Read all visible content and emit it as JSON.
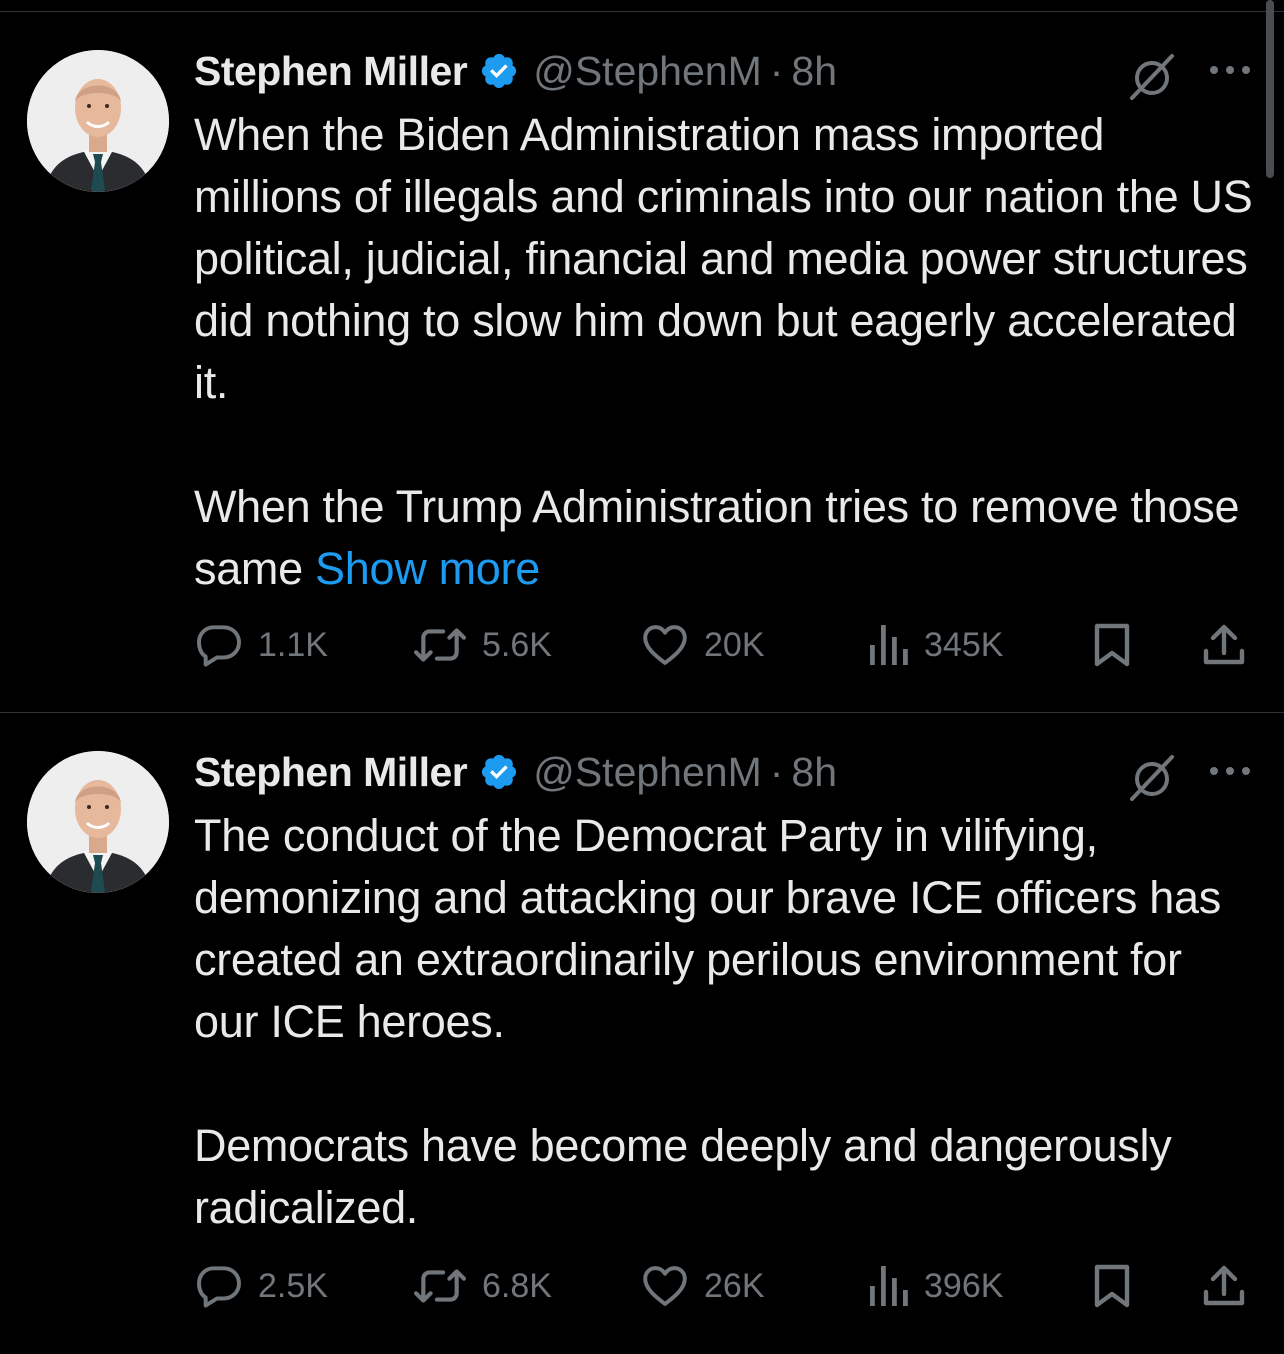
{
  "colors": {
    "background": "#000000",
    "text": "#e7e9ea",
    "muted": "#71767b",
    "accent": "#1d9bf0",
    "divider": "#2f3336"
  },
  "tweets": [
    {
      "author": {
        "name": "Stephen Miller",
        "verified_icon": "verified-badge-icon",
        "handle": "@StephenM",
        "separator": "·",
        "time": "8h"
      },
      "paragraphs": [
        "When the Biden Administration mass imported millions of illegals and criminals into our nation the US political, judicial, financial and media power structures did nothing to slow him down but eagerly accelerated it.",
        "When the Trump Administration tries to remove those same "
      ],
      "show_more": "Show more",
      "actions": {
        "replies": "1.1K",
        "reposts": "5.6K",
        "likes": "20K",
        "views": "345K"
      },
      "icons": [
        "grok-icon",
        "more-icon",
        "reply-icon",
        "repost-icon",
        "like-icon",
        "views-icon",
        "bookmark-icon",
        "share-icon"
      ]
    },
    {
      "author": {
        "name": "Stephen Miller",
        "verified_icon": "verified-badge-icon",
        "handle": "@StephenM",
        "separator": "·",
        "time": "8h"
      },
      "paragraphs": [
        "The conduct of the Democrat Party in vilifying, demonizing and attacking our brave ICE officers has created an extraordinarily perilous environment for our ICE heroes.",
        "Democrats have become deeply and dangerously radicalized."
      ],
      "actions": {
        "replies": "2.5K",
        "reposts": "6.8K",
        "likes": "26K",
        "views": "396K"
      },
      "icons": [
        "grok-icon",
        "more-icon",
        "reply-icon",
        "repost-icon",
        "like-icon",
        "views-icon",
        "bookmark-icon",
        "share-icon"
      ]
    }
  ]
}
